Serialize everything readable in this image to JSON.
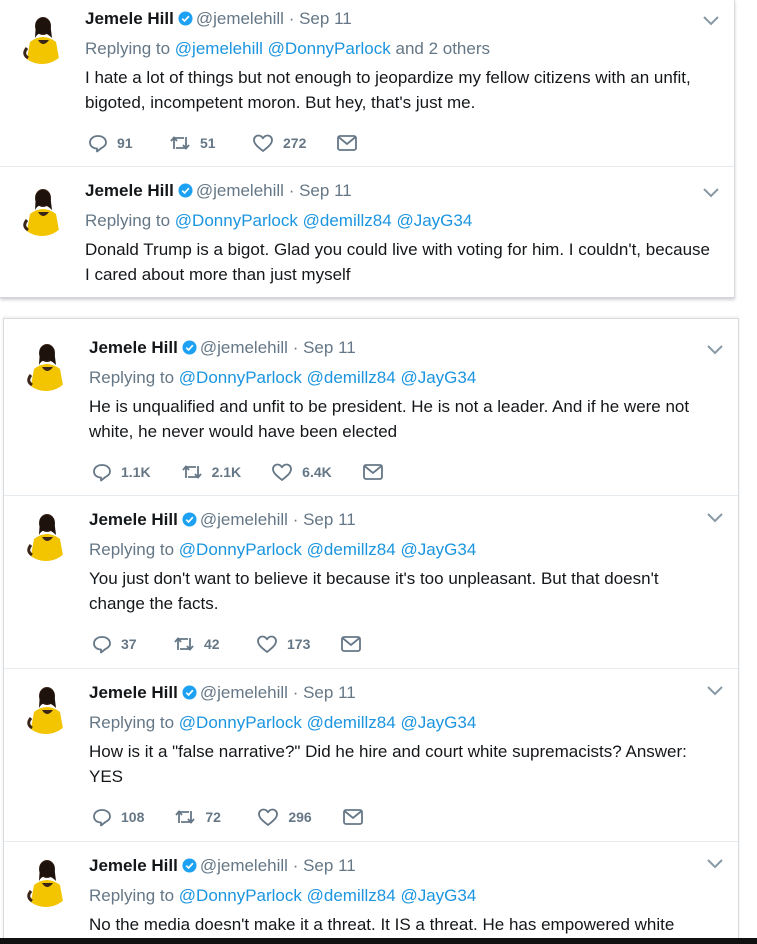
{
  "author": {
    "name": "Jemele Hill",
    "handle": "@jemelehill",
    "separator": "·",
    "date": "Sep 11"
  },
  "reply_prefix": "Replying to",
  "colors": {
    "link": "#1b95e0",
    "muted": "#657786",
    "text": "#14171a",
    "verified": "#1da1f2"
  },
  "icons": [
    "reply-icon",
    "retweet-icon",
    "like-icon",
    "dm-icon",
    "verified-badge-icon",
    "chevron-down-icon"
  ],
  "panel1": {
    "tweets": [
      {
        "replying_to": [
          "@jemelehill",
          "@DonnyParlock"
        ],
        "replying_suffix": "and 2 others",
        "text": "I hate a lot of things but not enough to jeopardize my fellow citizens with an unfit, bigoted, incompetent moron. But hey, that's just me.",
        "replies": "91",
        "retweets": "51",
        "likes": "272"
      },
      {
        "replying_to": [
          "@DonnyParlock",
          "@demillz84",
          "@JayG34"
        ],
        "text": "Donald Trump is a bigot. Glad you could live with voting for him. I couldn't, because I cared about more than just myself"
      }
    ]
  },
  "panel2": {
    "tweets": [
      {
        "replying_to": [
          "@DonnyParlock",
          "@demillz84",
          "@JayG34"
        ],
        "text": "He is unqualified and unfit to be president. He is not a leader. And if he were not white, he never would have been elected",
        "replies": "1.1K",
        "retweets": "2.1K",
        "likes": "6.4K"
      },
      {
        "replying_to": [
          "@DonnyParlock",
          "@demillz84",
          "@JayG34"
        ],
        "text": "You just don't want to believe it because it's too unpleasant. But that doesn't change the facts.",
        "replies": "37",
        "retweets": "42",
        "likes": "173"
      },
      {
        "replying_to": [
          "@DonnyParlock",
          "@demillz84",
          "@JayG34"
        ],
        "text": "How is it a \"false narrative?\" Did he hire and court white supremacists? Answer: YES",
        "replies": "108",
        "retweets": "72",
        "likes": "296"
      },
      {
        "replying_to": [
          "@DonnyParlock",
          "@demillz84",
          "@JayG34"
        ],
        "text": "No the media doesn't make it a threat. It IS a threat. He has empowered white"
      }
    ]
  }
}
